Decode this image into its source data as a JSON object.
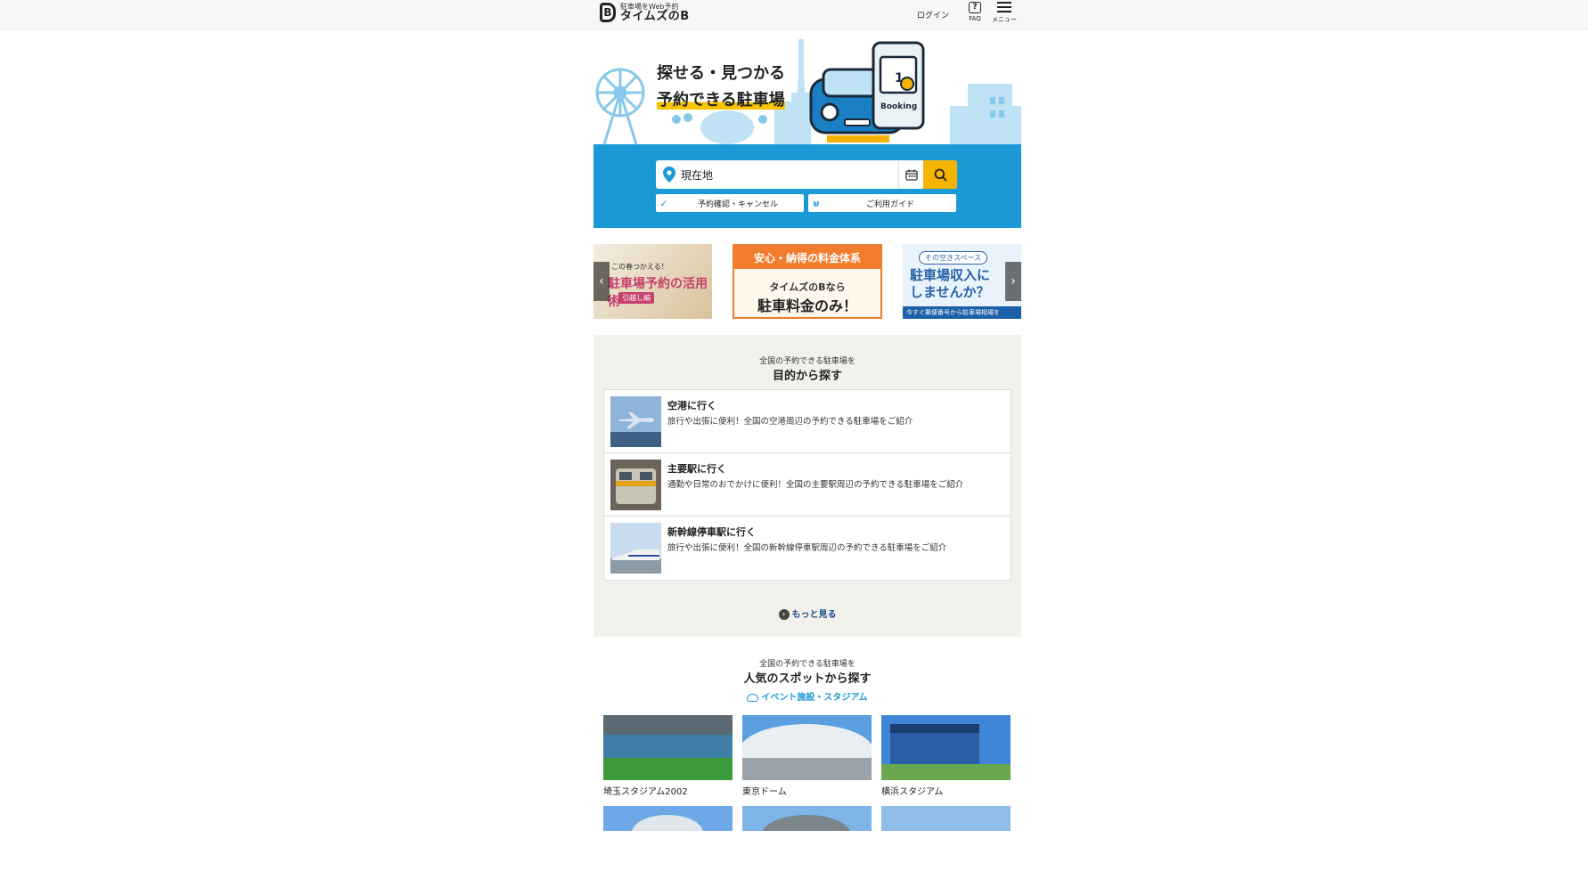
{
  "header": {
    "logo_sub": "駐車場をWeb予約",
    "logo_main": "タイムズのB",
    "logo_mark": "B",
    "login": "ログイン",
    "faq_icon_glyph": "?",
    "faq": "FAQ",
    "menu": "メニュー"
  },
  "hero": {
    "title_line1": "探せる・見つかる",
    "title_line2": "予約できる駐車場",
    "booking_label": "Booking",
    "booking_day": "1",
    "search_value": "現在地",
    "reservation_button": "予約確認・キャンセル",
    "guide_button": "ご利用ガイド"
  },
  "banners": [
    {
      "tag": "この春つかえる！",
      "title": "駐車場予約の活用術",
      "sub": "引越し編"
    },
    {
      "head": "安心・納得の料金体系",
      "line1": "タイムズのBなら",
      "line2": "駐車料金のみ！"
    },
    {
      "tag": "その空きスペース",
      "title": "駐車場収入に しませんか？",
      "foot": "今すぐ郵便番号から駐車場相場を"
    }
  ],
  "purpose": {
    "subtitle": "全国の予約できる駐車場を",
    "title": "目的から探す",
    "items": [
      {
        "title": "空港に行く",
        "desc": "旅行や出張に便利！全国の空港周辺の予約できる駐車場をご紹介"
      },
      {
        "title": "主要駅に行く",
        "desc": "通勤や日常のおでかけに便利！全国の主要駅周辺の予約できる駐車場をご紹介"
      },
      {
        "title": "新幹線停車駅に行く",
        "desc": "旅行や出張に便利！全国の新幹線停車駅周辺の予約できる駐車場をご紹介"
      }
    ],
    "more": "もっと見る"
  },
  "spots": {
    "subtitle": "全国の予約できる駐車場を",
    "title": "人気のスポットから探す",
    "category": "イベント施設・スタジアム",
    "items": [
      {
        "label": "埼玉スタジアム2002"
      },
      {
        "label": "東京ドーム"
      },
      {
        "label": "横浜スタジアム"
      }
    ]
  },
  "colors": {
    "accent_blue": "#1b9ad6",
    "accent_yellow": "#f5b400",
    "banner_orange": "#f07c2c",
    "section_bg": "#f3f1ec"
  }
}
